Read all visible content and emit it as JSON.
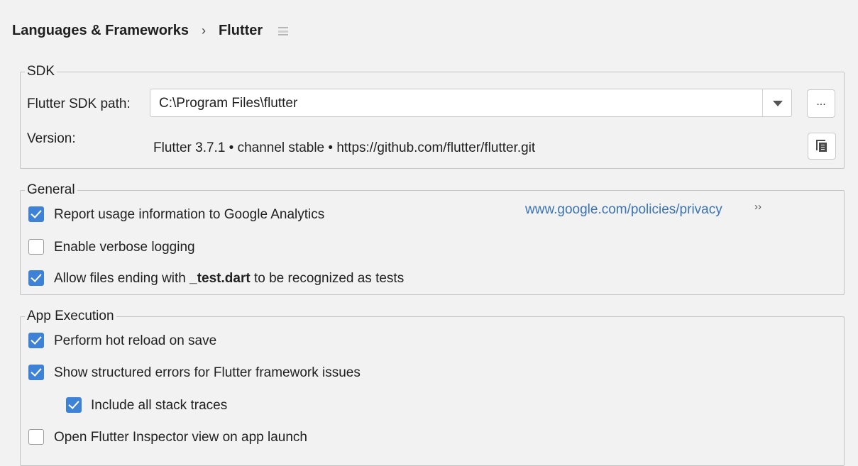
{
  "breadcrumb": {
    "parent": "Languages & Frameworks",
    "separator": "›",
    "current": "Flutter",
    "icon": "settings-scope-icon"
  },
  "sdk": {
    "legend": "SDK",
    "path_label": "Flutter SDK path:",
    "path_value": "C:\\Program Files\\flutter",
    "browse_label": "...",
    "version_label": "Version:",
    "version_value": "Flutter 3.7.1 • channel stable • https://github.com/flutter/flutter.git"
  },
  "general": {
    "legend": "General",
    "analytics": {
      "label": "Report usage information to Google Analytics",
      "checked": true
    },
    "privacy_link": "www.google.com/policies/privacy",
    "privacy_link_arrow": "››",
    "verbose": {
      "label": "Enable verbose logging",
      "checked": false
    },
    "tests": {
      "prefix": "Allow files ending with ",
      "bold": "_test.dart",
      "suffix": " to be recognized as tests",
      "checked": true
    }
  },
  "app_execution": {
    "legend": "App Execution",
    "hot_reload": {
      "label": "Perform hot reload on save",
      "checked": true
    },
    "structured_errors": {
      "label": "Show structured errors for Flutter framework issues",
      "checked": true
    },
    "stack_traces": {
      "label": "Include all stack traces",
      "checked": true
    },
    "inspector": {
      "label": "Open Flutter Inspector view on app launch",
      "checked": false
    }
  },
  "colors": {
    "checkbox_accent": "#3d82d6",
    "link": "#3a73b4",
    "background": "#f2f2f2"
  }
}
